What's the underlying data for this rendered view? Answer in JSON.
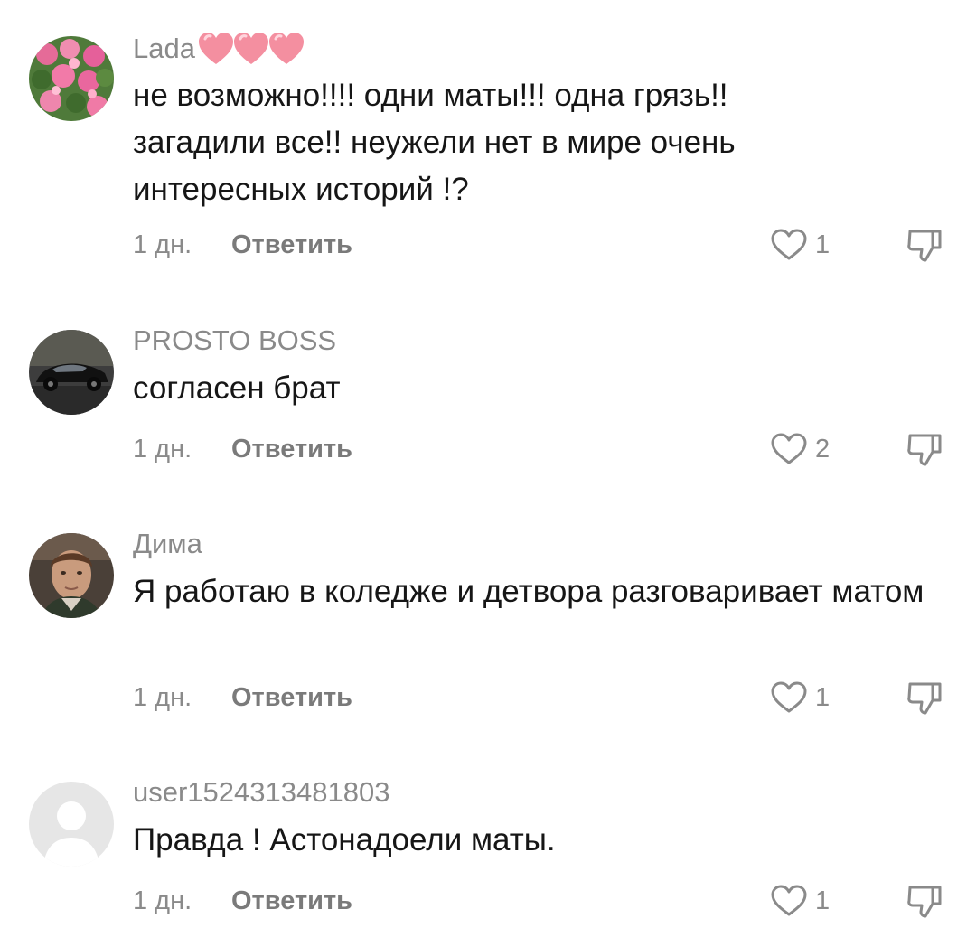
{
  "comments": [
    {
      "username": "Lada",
      "username_emoji": [
        "pink-heart",
        "pink-heart",
        "pink-heart"
      ],
      "text": "не возможно!!!! одни маты!!! одна грязь!! загадили все!! неужели нет в мире очень интересных историй !?",
      "time": "1 дн.",
      "reply_label": "Ответить",
      "likes": "1",
      "avatar": "pink-flowers-photo"
    },
    {
      "username": "PROSTO BOSS",
      "text": "согласен брат",
      "time": "1 дн.",
      "reply_label": "Ответить",
      "likes": "2",
      "avatar": "black-sports-car-photo"
    },
    {
      "username": "Дима",
      "text": "Я работаю в коледже и детвора разговаривает матом",
      "time": "1 дн.",
      "reply_label": "Ответить",
      "likes": "1",
      "avatar": "man-portrait-photo"
    },
    {
      "username": "user1524313481803",
      "text": "Правда ! Астонадоели маты.",
      "time": "1 дн.",
      "reply_label": "Ответить",
      "likes": "1",
      "avatar": "default-gray-user-avatar"
    }
  ],
  "icons": {
    "like": "heart-outline-icon",
    "dislike": "thumbs-down-outline-icon"
  },
  "colors": {
    "text": "#161616",
    "secondary": "#8a8a8a",
    "reply": "#7a7a7a",
    "heart_emoji": "#f48fa0"
  }
}
